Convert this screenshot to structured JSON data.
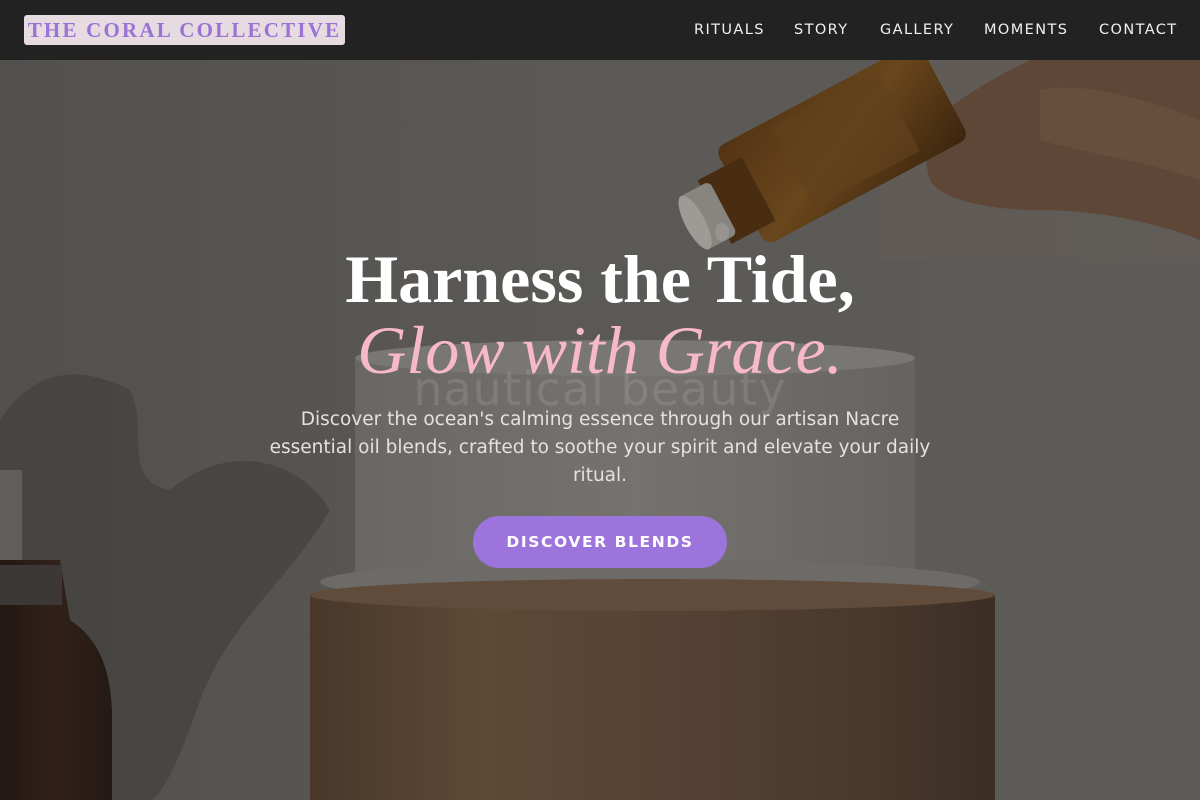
{
  "brand": {
    "name": "THE CORAL COLLECTIVE"
  },
  "nav": {
    "items": [
      {
        "label": "RITUALS"
      },
      {
        "label": "STORY"
      },
      {
        "label": "GALLERY"
      },
      {
        "label": "MOMENTS"
      },
      {
        "label": "CONTACT"
      }
    ]
  },
  "hero": {
    "background_text": "nautical beauty",
    "headline": "Harness the Tide,",
    "headline_accent": "Glow with Grace.",
    "subtitle": "Discover the ocean's calming essence through our artisan Nacre essential oil blends, crafted to soothe your spirit and elevate your daily ritual.",
    "cta_label": "DISCOVER BLENDS"
  },
  "colors": {
    "header_bg": "#222222",
    "brand_text": "#9b72d6",
    "brand_bg": "#e6dbe0",
    "accent_pink": "#f7b8cc",
    "cta_bg": "#9c74dc"
  }
}
